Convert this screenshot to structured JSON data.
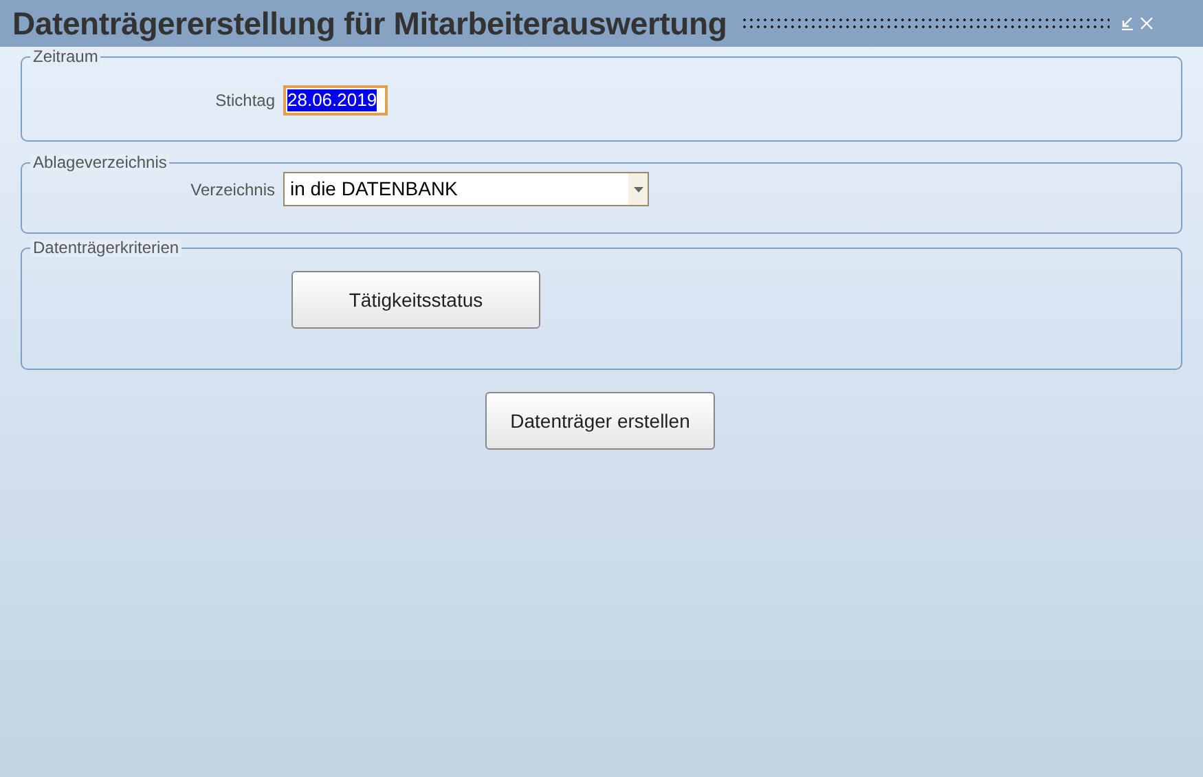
{
  "window": {
    "title": "Datenträgererstellung für Mitarbeiterauswertung"
  },
  "groups": [
    {
      "kind": "date",
      "legend": "Zeitraum",
      "label": "Stichtag",
      "value": "28.06.2019",
      "focused": true
    },
    {
      "kind": "dropdown",
      "legend": "Ablageverzeichnis",
      "label": "Verzeichnis",
      "value": "in die DATENBANK"
    },
    {
      "kind": "button",
      "legend": "Datenträgerkriterien",
      "button": "Tätigkeitsstatus"
    }
  ],
  "action_button": "Datenträger erstellen"
}
